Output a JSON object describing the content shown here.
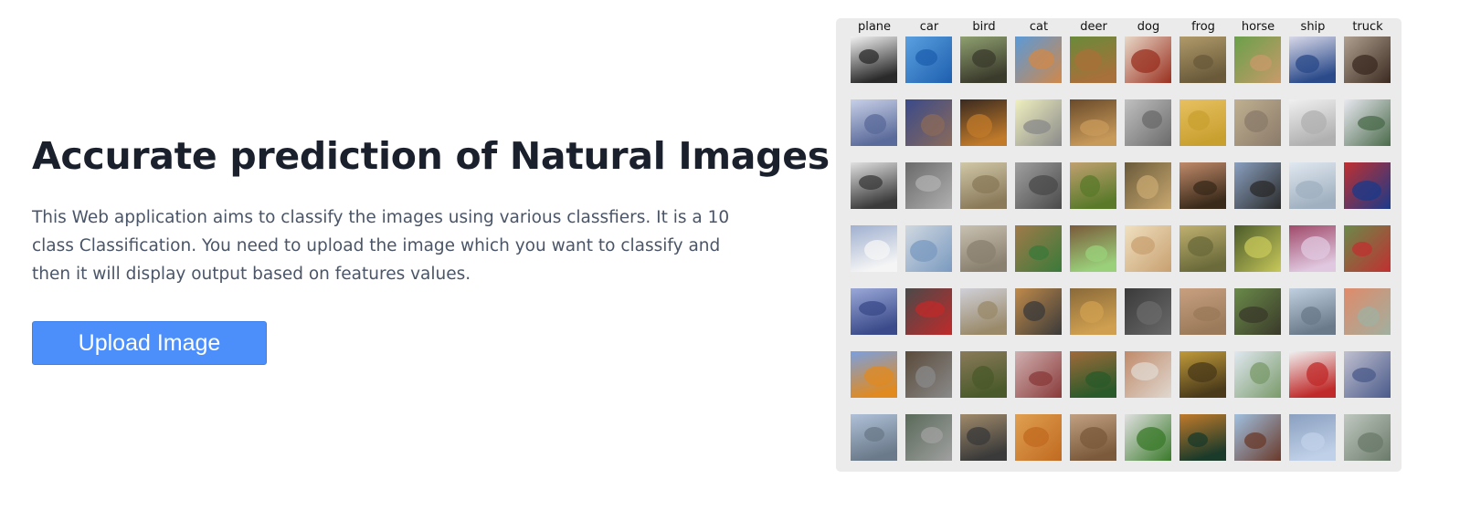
{
  "hero": {
    "title": "Accurate prediction of Natural Images",
    "description": "This Web application aims to classify the images using various classfiers. It is a 10 class Classification. You need to upload the image which you want to classify and then it will display output based on features values.",
    "upload_label": "Upload Image"
  },
  "colors": {
    "accent": "#4c8ffb",
    "heading": "#1a202c",
    "body_text": "#4a5568",
    "panel_bg": "#ebebeb"
  },
  "sample_grid": {
    "classes": [
      "plane",
      "car",
      "bird",
      "cat",
      "deer",
      "dog",
      "frog",
      "horse",
      "ship",
      "truck"
    ],
    "rows": 7,
    "thumbnails": [
      [
        [
          "#2a2a2a",
          "#f2f2f2"
        ],
        [
          "#1e5fae",
          "#5aa0e0"
        ],
        [
          "#3b3b2c",
          "#8fa070"
        ],
        [
          "#d0884a",
          "#5a9ad8"
        ],
        [
          "#a8703a",
          "#6a8a3a"
        ],
        [
          "#9a3020",
          "#e8d8c8"
        ],
        [
          "#6a5a3a",
          "#b09a6a"
        ],
        [
          "#c89a6a",
          "#6aa04a"
        ],
        [
          "#2a4a8a",
          "#d8d8e8"
        ],
        [
          "#3a2a20",
          "#b0a090"
        ]
      ],
      [
        [
          "#5a6a9a",
          "#c8d0e8"
        ],
        [
          "#8a6a5a",
          "#3a4a8a"
        ],
        [
          "#c07a2a",
          "#3a2a20"
        ],
        [
          "#8a8a8a",
          "#f0f0c0"
        ],
        [
          "#c89a5a",
          "#6a4a2a"
        ],
        [
          "#6a6a6a",
          "#c0c0c0"
        ],
        [
          "#c8a030",
          "#e8c060"
        ],
        [
          "#8a7a6a",
          "#c0b090"
        ],
        [
          "#b0b0b0",
          "#f0f0f0"
        ],
        [
          "#4a6a4a",
          "#e8e8f0"
        ]
      ],
      [
        [
          "#3a3a3a",
          "#e0e0e0"
        ],
        [
          "#b0b0b0",
          "#6a6a6a"
        ],
        [
          "#8a7a5a",
          "#d0c8a8"
        ],
        [
          "#4a4a4a",
          "#a0a0a0"
        ],
        [
          "#5a7a2a",
          "#c0a070"
        ],
        [
          "#c8a870",
          "#6a5a3a"
        ],
        [
          "#3a2a1a",
          "#c08a6a"
        ],
        [
          "#2a2a2a",
          "#8aa0c0"
        ],
        [
          "#a0b0c0",
          "#e0e8f0"
        ],
        [
          "#1a3a8a",
          "#c03030"
        ]
      ],
      [
        [
          "#f5f5f5",
          "#a0b0d0"
        ],
        [
          "#7a9ac0",
          "#d0d8e0"
        ],
        [
          "#8a8070",
          "#c8c0b0"
        ],
        [
          "#3a7a3a",
          "#a07a4a"
        ],
        [
          "#9ad07a",
          "#7a5a3a"
        ],
        [
          "#c8a070",
          "#f0e0c0"
        ],
        [
          "#6a6a3a",
          "#c0b070"
        ],
        [
          "#c8c85a",
          "#4a5a2a"
        ],
        [
          "#e0c8e0",
          "#a04a6a"
        ],
        [
          "#c03030",
          "#6a8a4a"
        ]
      ],
      [
        [
          "#3a4a8a",
          "#9aa8d8"
        ],
        [
          "#c02a2a",
          "#4a4a4a"
        ],
        [
          "#9a8a6a",
          "#d0d0d8"
        ],
        [
          "#3a3a3a",
          "#c08a4a"
        ],
        [
          "#d0a050",
          "#8a6a3a"
        ],
        [
          "#6a6a6a",
          "#3a3a3a"
        ],
        [
          "#9a7a5a",
          "#c8a080"
        ],
        [
          "#3a3a2a",
          "#6a8a4a"
        ],
        [
          "#6a7a8a",
          "#c0d0e0"
        ],
        [
          "#a0b0a0",
          "#e08a6a"
        ]
      ],
      [
        [
          "#e08a20",
          "#7aa0e0"
        ],
        [
          "#8a8a8a",
          "#5a4a3a"
        ],
        [
          "#4a5a2a",
          "#8a7a5a"
        ],
        [
          "#8a3a3a",
          "#d0b0b0"
        ],
        [
          "#2a5a2a",
          "#a06a3a"
        ],
        [
          "#e0d8d0",
          "#c08a6a"
        ],
        [
          "#4a3a1a",
          "#c09a3a"
        ],
        [
          "#7a9a6a",
          "#e0e8f0"
        ],
        [
          "#c02a2a",
          "#f0f0f0"
        ],
        [
          "#4a5a8a",
          "#c0c0d0"
        ]
      ],
      [
        [
          "#6a7a8a",
          "#b0c0d8"
        ],
        [
          "#a0a0a0",
          "#5a6a5a"
        ],
        [
          "#3a3a3a",
          "#a08a6a"
        ],
        [
          "#c06a20",
          "#e0a050"
        ],
        [
          "#7a5a3a",
          "#c0a080"
        ],
        [
          "#3a7a2a",
          "#e0e0e0"
        ],
        [
          "#1a3a2a",
          "#c07a2a"
        ],
        [
          "#6a3a2a",
          "#a0c0e0"
        ],
        [
          "#c0d0e8",
          "#8aa0c0"
        ],
        [
          "#6a7a6a",
          "#c0c8c0"
        ]
      ]
    ]
  }
}
